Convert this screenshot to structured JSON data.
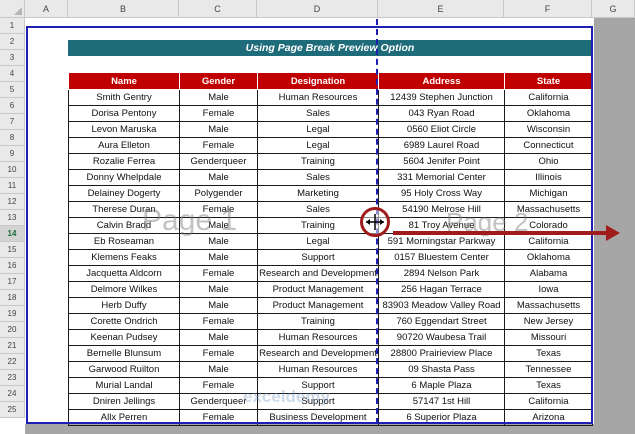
{
  "columns": [
    "A",
    "B",
    "C",
    "D",
    "E",
    "F",
    "G"
  ],
  "rows": [
    "1",
    "2",
    "3",
    "4",
    "5",
    "6",
    "7",
    "8",
    "9",
    "10",
    "11",
    "12",
    "13",
    "14",
    "15",
    "16",
    "17",
    "18",
    "19",
    "20",
    "21",
    "22",
    "23",
    "24",
    "25"
  ],
  "selected_row": "14",
  "title": "Using Page Break Preview Option",
  "table": {
    "headers": [
      "Name",
      "Gender",
      "Designation",
      "Address",
      "State"
    ],
    "rows": [
      [
        "Smith Gentry",
        "Male",
        "Human Resources",
        "12439 Stephen Junction",
        "California"
      ],
      [
        "Dorisa Pentony",
        "Female",
        "Sales",
        "043 Ryan Road",
        "Oklahoma"
      ],
      [
        "Levon Maruska",
        "Male",
        "Legal",
        "0560 Eliot Circle",
        "Wisconsin"
      ],
      [
        "Aura Elleton",
        "Female",
        "Legal",
        "6989 Laurel Road",
        "Connecticut"
      ],
      [
        "Rozalie Ferrea",
        "Genderqueer",
        "Training",
        "5604 Jenifer Point",
        "Ohio"
      ],
      [
        "Donny Whelpdale",
        "Male",
        "Sales",
        "331 Memorial Center",
        "Illinois"
      ],
      [
        "Delainey Dogerty",
        "Polygender",
        "Marketing",
        "95 Holy Cross Way",
        "Michigan"
      ],
      [
        "Therese Duran",
        "Female",
        "Sales",
        "54190 Melrose Hill",
        "Massachusetts"
      ],
      [
        "Calvin Bradd",
        "Male",
        "Training",
        "81 Troy Avenue",
        "Colorado"
      ],
      [
        "Eb Roseaman",
        "Male",
        "Legal",
        "591 Morningstar Parkway",
        "California"
      ],
      [
        "Klemens Feaks",
        "Male",
        "Support",
        "0157 Bluestem Center",
        "Oklahoma"
      ],
      [
        "Jacquetta Aldcorn",
        "Female",
        "Research and Development",
        "2894 Nelson Park",
        "Alabama"
      ],
      [
        "Delmore Wilkes",
        "Male",
        "Product Management",
        "256 Hagan Terrace",
        "Iowa"
      ],
      [
        "Herb Duffy",
        "Male",
        "Product Management",
        "83903 Meadow Valley Road",
        "Massachusetts"
      ],
      [
        "Corette Ondrich",
        "Female",
        "Training",
        "760 Eggendart Street",
        "New Jersey"
      ],
      [
        "Keenan Pudsey",
        "Male",
        "Human Resources",
        "90720 Waubesa Trail",
        "Missouri"
      ],
      [
        "Bernelle Blunsum",
        "Female",
        "Research and Development",
        "28800 Prairieview Place",
        "Texas"
      ],
      [
        "Garwood Ruilton",
        "Male",
        "Human Resources",
        "09 Shasta Pass",
        "Tennessee"
      ],
      [
        "Murial Landal",
        "Female",
        "Support",
        "6 Maple Plaza",
        "Texas"
      ],
      [
        "Dniren Jellings",
        "Genderqueer",
        "Support",
        "57147 1st Hill",
        "California"
      ],
      [
        "Allx Perren",
        "Female",
        "Business Development",
        "6 Superior Plaza",
        "Arizona"
      ]
    ]
  },
  "page_labels": [
    "Page 1",
    "Page 2"
  ],
  "watermark": "exceldemy",
  "cursor_icon": "resize-horizontal-icon",
  "colors": {
    "title_bg": "#1e6b7a",
    "header_bg": "#c00000",
    "print_border": "#1f1fb4",
    "annotation": "#a01c1c",
    "outside": "#a6a6a6"
  }
}
